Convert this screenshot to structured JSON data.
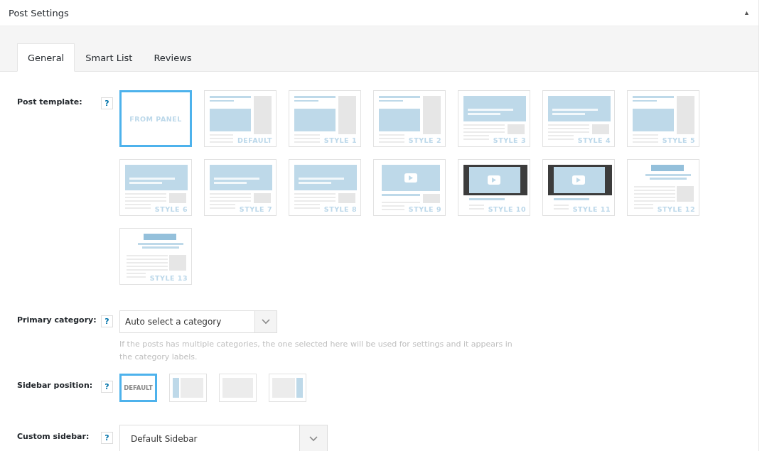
{
  "panel": {
    "title": "Post Settings",
    "collapse": "▲"
  },
  "tabs": [
    {
      "label": "General",
      "selected": true
    },
    {
      "label": "Smart List",
      "selected": false
    },
    {
      "label": "Reviews",
      "selected": false
    }
  ],
  "post_template": {
    "label": "Post template:",
    "help": "?",
    "options": [
      {
        "label": "FROM PANEL",
        "kind": "panel",
        "selected": true
      },
      {
        "label": "DEFAULT",
        "kind": "sidebar",
        "selected": false
      },
      {
        "label": "STYLE 1",
        "kind": "sidebar",
        "selected": false
      },
      {
        "label": "STYLE 2",
        "kind": "sidebar",
        "selected": false
      },
      {
        "label": "STYLE 3",
        "kind": "hero",
        "selected": false
      },
      {
        "label": "STYLE 4",
        "kind": "hero",
        "selected": false
      },
      {
        "label": "STYLE 5",
        "kind": "sidebar",
        "selected": false
      },
      {
        "label": "STYLE 6",
        "kind": "hero",
        "selected": false
      },
      {
        "label": "STYLE 7",
        "kind": "hero",
        "selected": false
      },
      {
        "label": "STYLE 8",
        "kind": "hero",
        "selected": false
      },
      {
        "label": "STYLE 9",
        "kind": "video",
        "selected": false
      },
      {
        "label": "STYLE 10",
        "kind": "dark-video",
        "selected": false
      },
      {
        "label": "STYLE 11",
        "kind": "dark-video",
        "selected": false
      },
      {
        "label": "STYLE 12",
        "kind": "ad",
        "selected": false
      },
      {
        "label": "STYLE 13",
        "kind": "ad",
        "selected": false
      }
    ]
  },
  "primary_category": {
    "label": "Primary category:",
    "help": "?",
    "value": "Auto select a category",
    "hint": "If the posts has multiple categories, the one selected here will be used for settings and it appears in the category labels."
  },
  "sidebar_position": {
    "label": "Sidebar position:",
    "help": "?",
    "options": [
      {
        "kind": "default",
        "label": "DEFAULT",
        "selected": true
      },
      {
        "kind": "left",
        "selected": false
      },
      {
        "kind": "none",
        "selected": false
      },
      {
        "kind": "right",
        "selected": false
      }
    ]
  },
  "custom_sidebar": {
    "label": "Custom sidebar:",
    "help": "?",
    "value": "Default Sidebar"
  }
}
